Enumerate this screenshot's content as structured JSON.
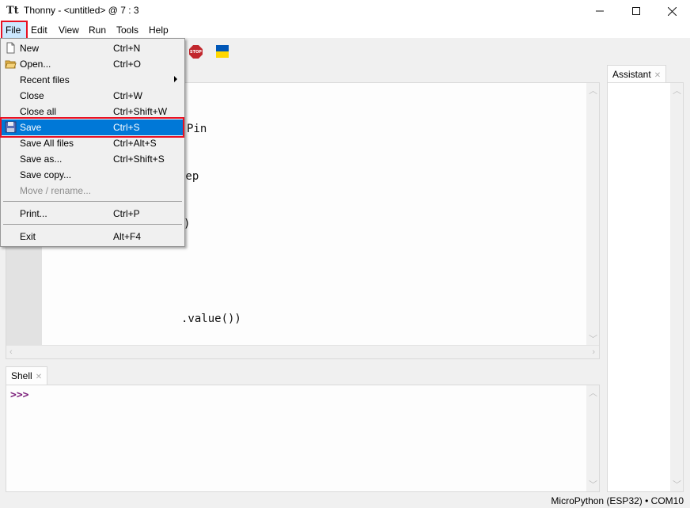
{
  "window": {
    "title": "Thonny  -  <untitled>  @  7 : 3",
    "app_icon": "Tt",
    "controls": {
      "minimize": "—",
      "maximize": "☐",
      "close": "✕"
    }
  },
  "menubar": {
    "items": [
      {
        "label": "File",
        "active": true
      },
      {
        "label": "Edit"
      },
      {
        "label": "View"
      },
      {
        "label": "Run"
      },
      {
        "label": "Tools"
      },
      {
        "label": "Help"
      }
    ]
  },
  "toolbar": {
    "stop_label": "STOP",
    "flag": {
      "top_color": "#0057b7",
      "bottom_color": "#ffd700"
    }
  },
  "file_menu": {
    "items": [
      {
        "label": "New",
        "shortcut": "Ctrl+N",
        "icon": "new-file-icon"
      },
      {
        "label": "Open...",
        "shortcut": "Ctrl+O",
        "icon": "folder-open-icon"
      },
      {
        "label": "Recent files",
        "shortcut": "",
        "submenu": true
      },
      {
        "label": "Close",
        "shortcut": "Ctrl+W"
      },
      {
        "label": "Close all",
        "shortcut": "Ctrl+Shift+W"
      },
      {
        "label": "Save",
        "shortcut": "Ctrl+S",
        "icon": "floppy-disk-icon",
        "highlighted": true
      },
      {
        "label": "Save All files",
        "shortcut": "Ctrl+Alt+S"
      },
      {
        "label": "Save as...",
        "shortcut": "Ctrl+Shift+S"
      },
      {
        "label": "Save copy...",
        "shortcut": ""
      },
      {
        "label": "Move / rename...",
        "shortcut": "",
        "disabled": true
      },
      {
        "label": "Print...",
        "shortcut": "Ctrl+P"
      },
      {
        "label": "Exit",
        "shortcut": "Alt+F4"
      }
    ]
  },
  "editor": {
    "visible_code_fragments": [
      "Pin",
      "eep",
      ")",
      "",
      ".value())"
    ]
  },
  "shell": {
    "tab_label": "Shell",
    "prompt": ">>>"
  },
  "assistant": {
    "tab_label": "Assistant"
  },
  "statusbar": {
    "text": "MicroPython (ESP32)  •  COM10"
  },
  "colors": {
    "highlight": "#0078d7",
    "annotation_red": "#e81123",
    "prompt": "#7b1e7a"
  }
}
